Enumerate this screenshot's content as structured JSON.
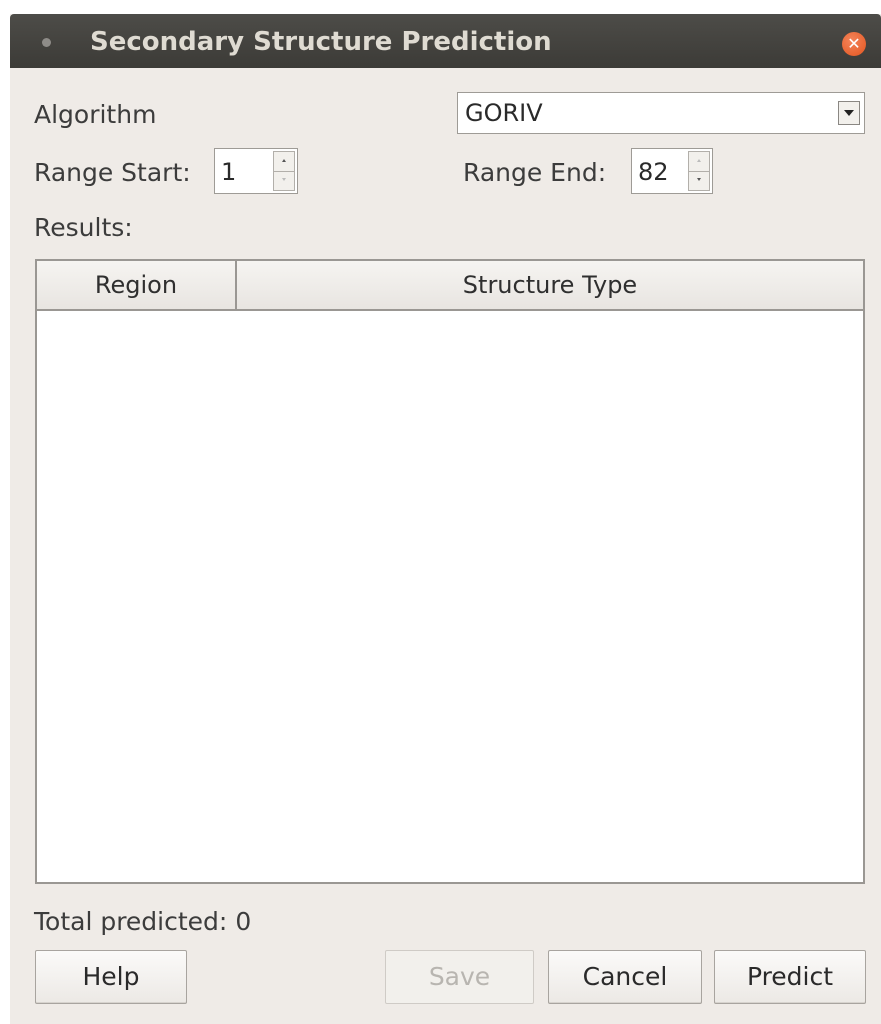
{
  "window": {
    "title": "Secondary Structure Prediction"
  },
  "algorithm": {
    "label": "Algorithm",
    "selected": "GORIV"
  },
  "range": {
    "start_label": "Range Start:",
    "start_value": "1",
    "end_label": "Range End:",
    "end_value": "82"
  },
  "results": {
    "label": "Results:",
    "columns": [
      "Region",
      "Structure Type"
    ],
    "rows": []
  },
  "status": {
    "total_label": "Total predicted:",
    "total_value": "0"
  },
  "buttons": {
    "help": "Help",
    "save": "Save",
    "cancel": "Cancel",
    "predict": "Predict"
  },
  "icons": {
    "close": "close-icon",
    "app": "app-menu-icon",
    "dropdown": "chevron-down-icon"
  },
  "colors": {
    "titlebar": "#3c3b37",
    "dialog_bg": "#efebe7",
    "close": "#e2551f"
  }
}
